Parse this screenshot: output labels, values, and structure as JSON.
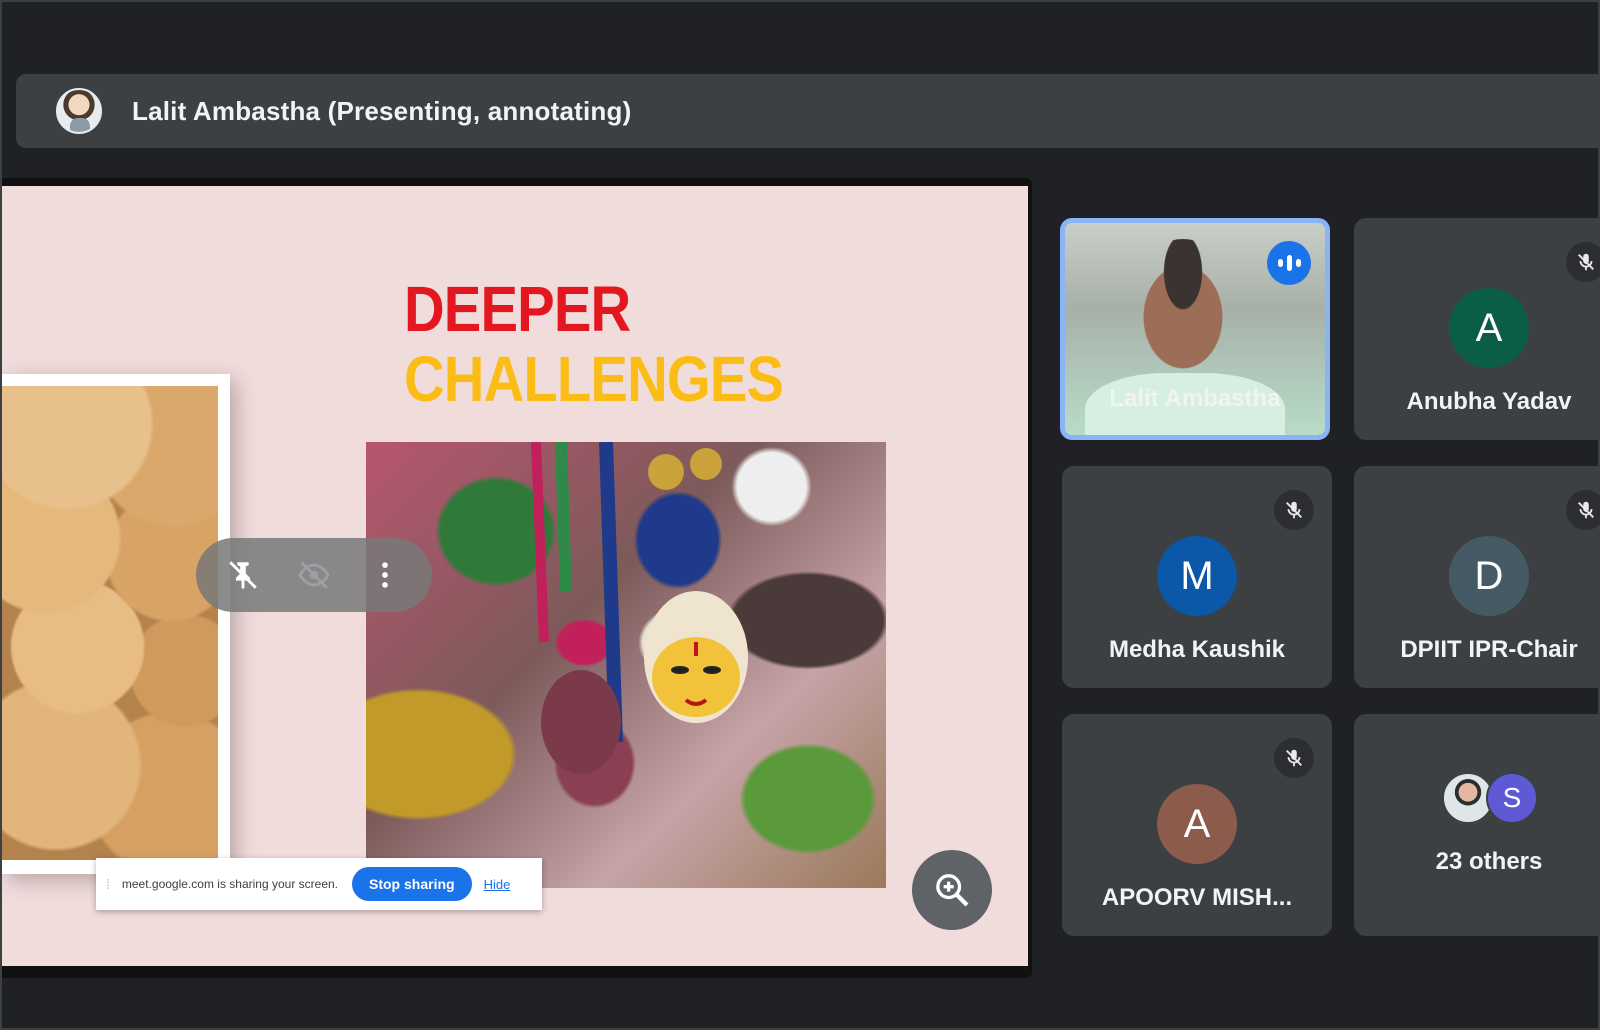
{
  "presenter_banner": {
    "title": "Lalit Ambastha (Presenting, annotating)"
  },
  "slide": {
    "title_line1": "DEEPER",
    "title_line2": "CHALLENGES",
    "title_color1": "#e3171f",
    "title_color2": "#fbbd15"
  },
  "annotation_toolbar": {
    "icons": [
      "pin-off-icon",
      "hide-icon",
      "more-vert-icon"
    ]
  },
  "share_bar": {
    "message": "meet.google.com is sharing your screen.",
    "stop_label": "Stop sharing",
    "hide_label": "Hide"
  },
  "participants": [
    {
      "name": "Lalit Ambastha",
      "speaking": true
    },
    {
      "name": "Anubha Yadav",
      "initial": "A",
      "color": "#0b5e46",
      "muted": true
    },
    {
      "name": "Medha Kaushik",
      "initial": "M",
      "color": "#0b57a8",
      "muted": true
    },
    {
      "name": "DPIIT IPR-Chair",
      "initial": "D",
      "color": "#455a64",
      "muted": true
    },
    {
      "name": "APOORV MISH...",
      "initial": "A",
      "color": "#8d5b4c",
      "muted": true
    }
  ],
  "others": {
    "label": "23 others",
    "initial": "S"
  },
  "colors": {
    "accent": "#1a73e8",
    "active_border": "#8ab4f8"
  }
}
